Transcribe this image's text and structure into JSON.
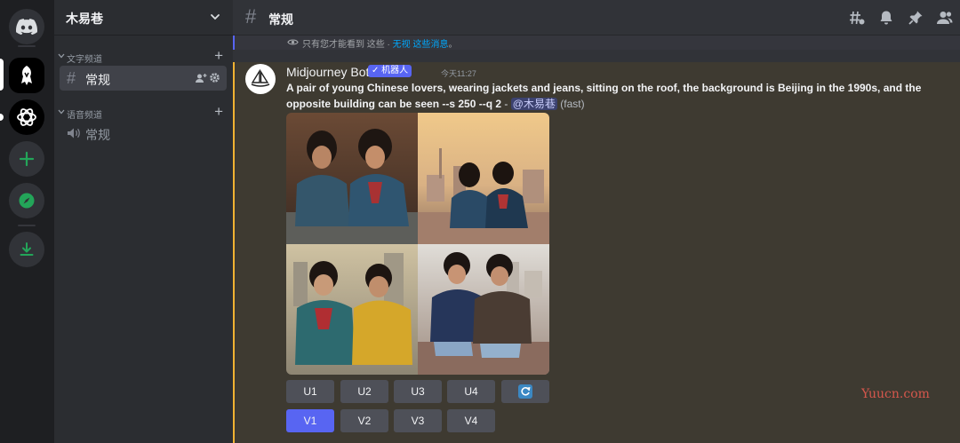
{
  "guild": {
    "name": "木易巷"
  },
  "rail": {
    "servers": [
      {
        "name": "discord-home"
      },
      {
        "name": "midjourney-server"
      },
      {
        "name": "openai-server"
      },
      {
        "name": "add-server"
      },
      {
        "name": "explore-servers"
      },
      {
        "name": "download-apps"
      }
    ]
  },
  "categories": [
    {
      "label": "文字频道",
      "channels": [
        {
          "name": "常规",
          "type": "text"
        }
      ]
    },
    {
      "label": "语音频道",
      "channels": [
        {
          "name": "常规",
          "type": "voice"
        }
      ]
    }
  ],
  "header": {
    "channel": "常规"
  },
  "ephemeral": {
    "text": "只有您才能看到 这些 · ",
    "link": "无视 这些消息",
    "end": "。"
  },
  "message": {
    "author": "Midjourney Bot",
    "bot_tag": "机器人",
    "time": "今天11:27",
    "prompt_bold": "A pair of young Chinese lovers, wearing jackets and jeans, sitting on the roof, the background is Beijing in the 1990s, and the opposite building can be seen --s 250 --q 2",
    "dash": " - ",
    "mention": "@木易巷",
    "speed": " (fast)"
  },
  "buttons": {
    "row1": [
      "U1",
      "U2",
      "U3",
      "U4"
    ],
    "row2": [
      "V1",
      "V2",
      "V3",
      "V4"
    ]
  },
  "watermark": "Yuucn.com",
  "colors": {
    "accent": "#5865f2",
    "highlight": "#f0b232",
    "link": "#00a8fc"
  }
}
